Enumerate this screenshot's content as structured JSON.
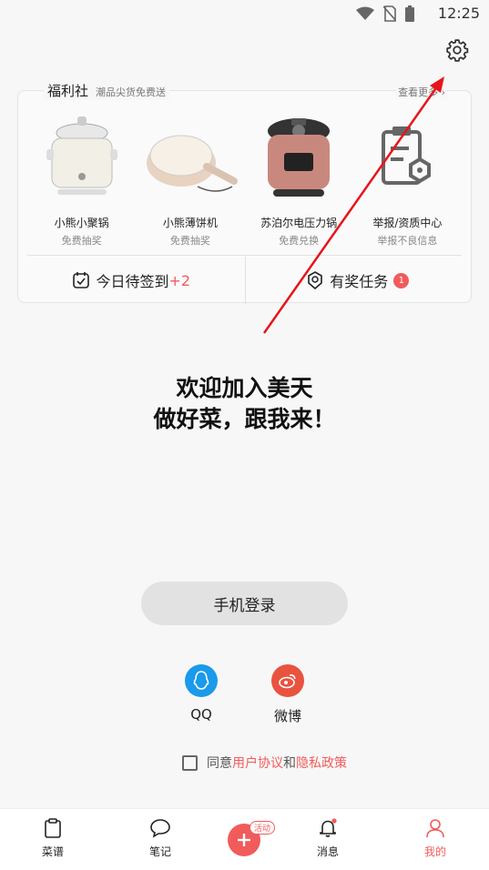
{
  "status_bar": {
    "time": "12:25"
  },
  "welfare": {
    "title": "福利社",
    "subtitle": "潮品尖货免费送",
    "more": "查看更多",
    "products": [
      {
        "name": "小熊小聚锅",
        "desc": "免费抽奖",
        "icon": "hotpot-icon"
      },
      {
        "name": "小熊薄饼机",
        "desc": "免费抽奖",
        "icon": "crepe-maker-icon"
      },
      {
        "name": "苏泊尔电压力锅",
        "desc": "免费兑换",
        "icon": "pressure-cooker-icon"
      },
      {
        "name": "举报/资质中心",
        "desc": "举报不良信息",
        "icon": "report-clipboard-icon"
      }
    ],
    "checkin": {
      "label": "今日待签到",
      "bonus": "+2"
    },
    "tasks": {
      "label": "有奖任务",
      "badge": "1"
    }
  },
  "welcome": {
    "line1": "欢迎加入美天",
    "line2": "做好菜，跟我来！"
  },
  "login": {
    "phone_button": "手机登录"
  },
  "socials": [
    {
      "label": "QQ",
      "color": "#1a9aea",
      "icon": "qq-icon"
    },
    {
      "label": "微博",
      "color": "#e8533f",
      "icon": "weibo-icon"
    }
  ],
  "agreement": {
    "prefix": "同意",
    "user_agreement": "用户协议",
    "and": "和",
    "privacy": "隐私政策"
  },
  "nav": {
    "items": [
      {
        "label": "菜谱"
      },
      {
        "label": "笔记"
      },
      {
        "label": "消息"
      },
      {
        "label": "我的"
      }
    ],
    "tag": "活动"
  },
  "colors": {
    "accent": "#f15b5b",
    "annotation": "#e8141b"
  }
}
